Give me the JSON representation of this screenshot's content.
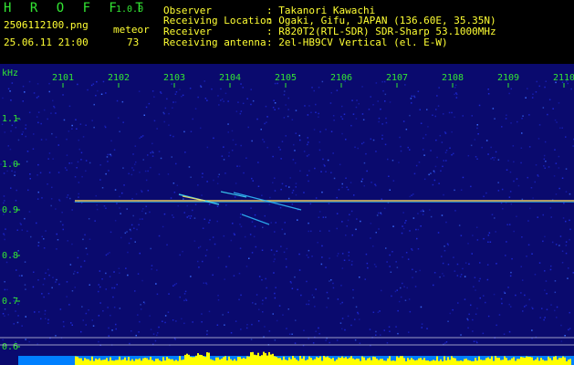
{
  "header": {
    "logo": "H R O F F T",
    "version": "1.0.0",
    "filename": "2506112100.png",
    "datetime": "25.06.11 21:00",
    "meteor_label": "meteor",
    "meteor_count": "73",
    "fields": [
      {
        "label": "Observer",
        "value": ": Takanori Kawachi"
      },
      {
        "label": "Receiving Location",
        "value": ": Ogaki, Gifu, JAPAN (136.60E, 35.35N)"
      },
      {
        "label": "Receiver",
        "value": ": R820T2(RTL-SDR) SDR-Sharp 53.1000MHz"
      },
      {
        "label": "Receiving antenna",
        "value": ": 2el-HB9CV Vertical (el. E-W)"
      }
    ]
  },
  "spectrogram": {
    "unit_label": "kHz",
    "time_ticks": [
      "2101",
      "2102",
      "2103",
      "2104",
      "2105",
      "2106",
      "2107",
      "2108",
      "2109",
      "2110"
    ],
    "freq_ticks": [
      "1.1",
      "1.0",
      "0.9",
      "0.8",
      "0.7",
      "0.6"
    ],
    "carrier_khz": 0.92,
    "colors": {
      "background": "#0a0a6e",
      "noise": "#1e2ad8",
      "carrier": "#ffe060",
      "axis_text": "#33e633",
      "level_bar": "#ffff00",
      "level_base": "#0080ff",
      "gridline": "#ffffff"
    }
  }
}
